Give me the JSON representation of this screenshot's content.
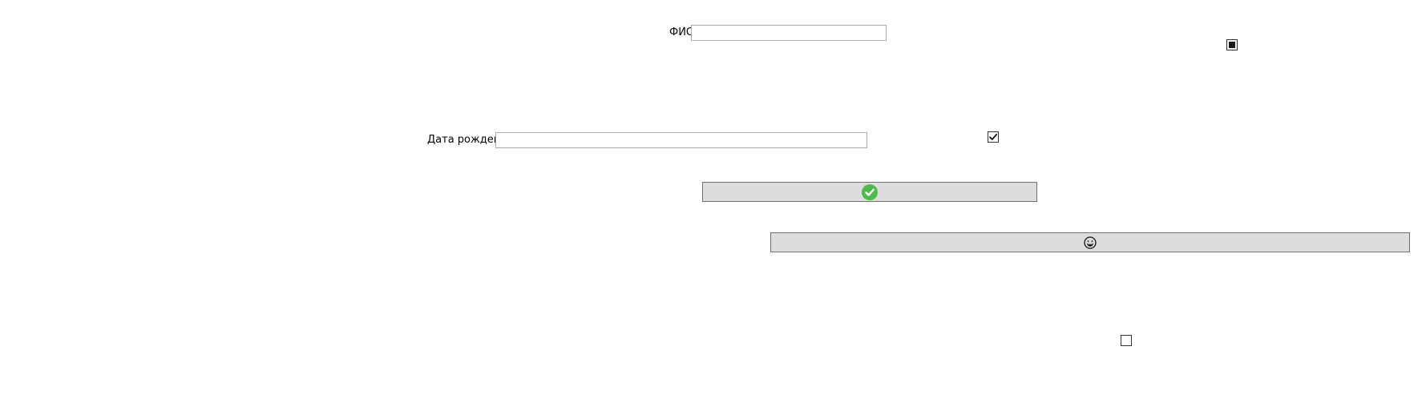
{
  "form": {
    "fio": {
      "label": "ФИО",
      "value": "",
      "placeholder": ""
    },
    "birth_date": {
      "label": "Дата рождения",
      "value": "",
      "placeholder": ""
    }
  },
  "checkboxes": [
    {
      "state": "indeterminate"
    },
    {
      "state": "checked"
    },
    {
      "state": "unchecked"
    }
  ],
  "buttons": {
    "confirm": {
      "icon": "check-circle-icon",
      "icon_color": "#4dbb4a"
    },
    "emoji": {
      "icon": "grinning-face-icon"
    }
  }
}
